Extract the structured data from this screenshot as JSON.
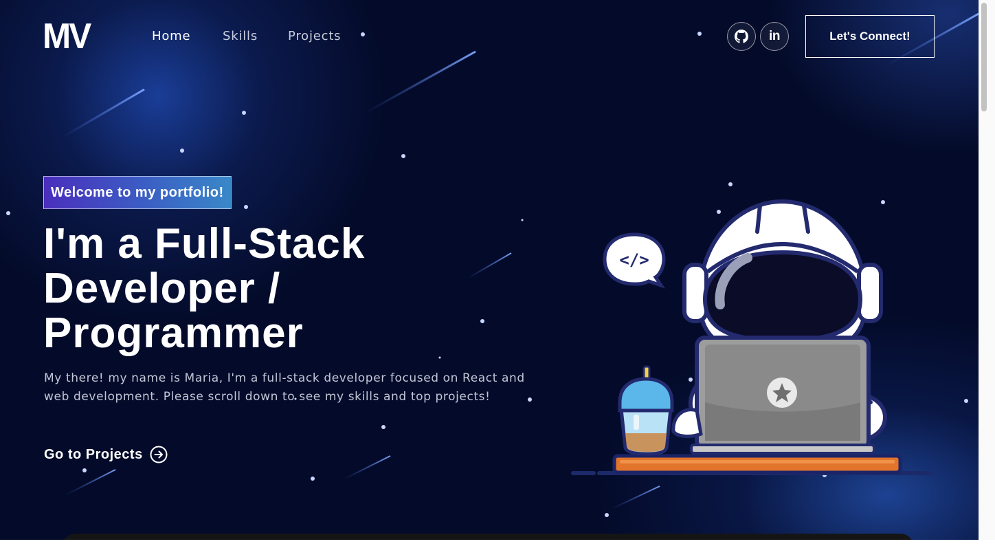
{
  "nav": {
    "logo": "MV",
    "links": [
      {
        "label": "Home",
        "active": true
      },
      {
        "label": "Skills",
        "active": false
      },
      {
        "label": "Projects",
        "active": false
      }
    ],
    "social": [
      {
        "icon": "github-icon"
      },
      {
        "icon": "linkedin-icon",
        "glyph": "in"
      }
    ],
    "connect_label": "Let's Connect!"
  },
  "hero": {
    "tagline": "Welcome to my portfolio!",
    "headline_lines": [
      "I'm a Full-Stack",
      "Developer /",
      "Programmer"
    ],
    "intro": "My there! my name is Maria, I'm a full-stack developer focused on React and web development. Please scroll down to see my skills and top projects!",
    "cta_label": "Go to Projects",
    "cta_icon": "arrow-right-circle-icon",
    "code_bubble": "</>",
    "illustration_icons": [
      "astronaut-icon",
      "laptop-icon",
      "speech-bubble-icon",
      "drink-cup-icon"
    ]
  },
  "colors": {
    "background": "#040b2a",
    "tagline_gradient_start": "#4a2fbd",
    "tagline_gradient_end": "#3a88c8",
    "text_primary": "#ffffff",
    "text_secondary": "#c2c6d6",
    "desk": "#e2742b"
  }
}
